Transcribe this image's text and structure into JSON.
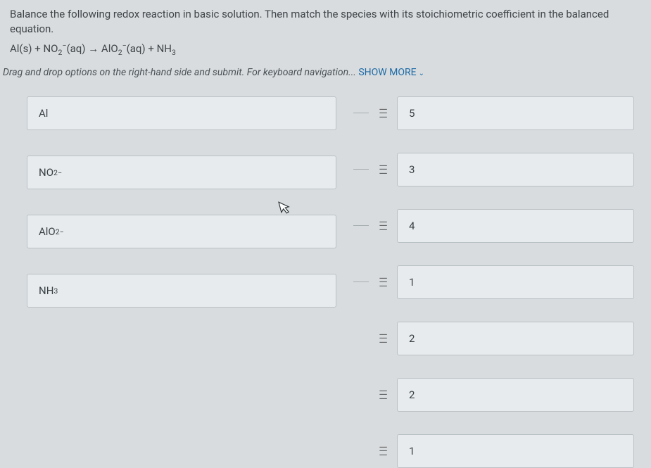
{
  "question": {
    "text": "Balance the following redox reaction in basic solution. Then match the species with its stoichiometric coefficient in the balanced equation.",
    "equation_html": "Al(s) + NO<sub>2</sub><sup>−</sup>(aq) → AlO<sub>2</sub><sup>−</sup>(aq) + NH<sub>3</sub>"
  },
  "instructions": {
    "prefix": "Drag and drop options on the right-hand side and submit. For keyboard navigation... ",
    "link": "SHOW MORE"
  },
  "left_items": [
    {
      "label_html": "Al"
    },
    {
      "label_html": "NO<sub>2</sub><sup>−</sup>"
    },
    {
      "label_html": "AlO<sub>2</sub><sup>−</sup>"
    },
    {
      "label_html": "NH<sub>3</sub>"
    }
  ],
  "right_items": [
    {
      "value": "5",
      "connected": true
    },
    {
      "value": "3",
      "connected": true
    },
    {
      "value": "4",
      "connected": true
    },
    {
      "value": "1",
      "connected": true
    },
    {
      "value": "2",
      "connected": false
    },
    {
      "value": "2",
      "connected": false
    },
    {
      "value": "1",
      "connected": false
    }
  ]
}
